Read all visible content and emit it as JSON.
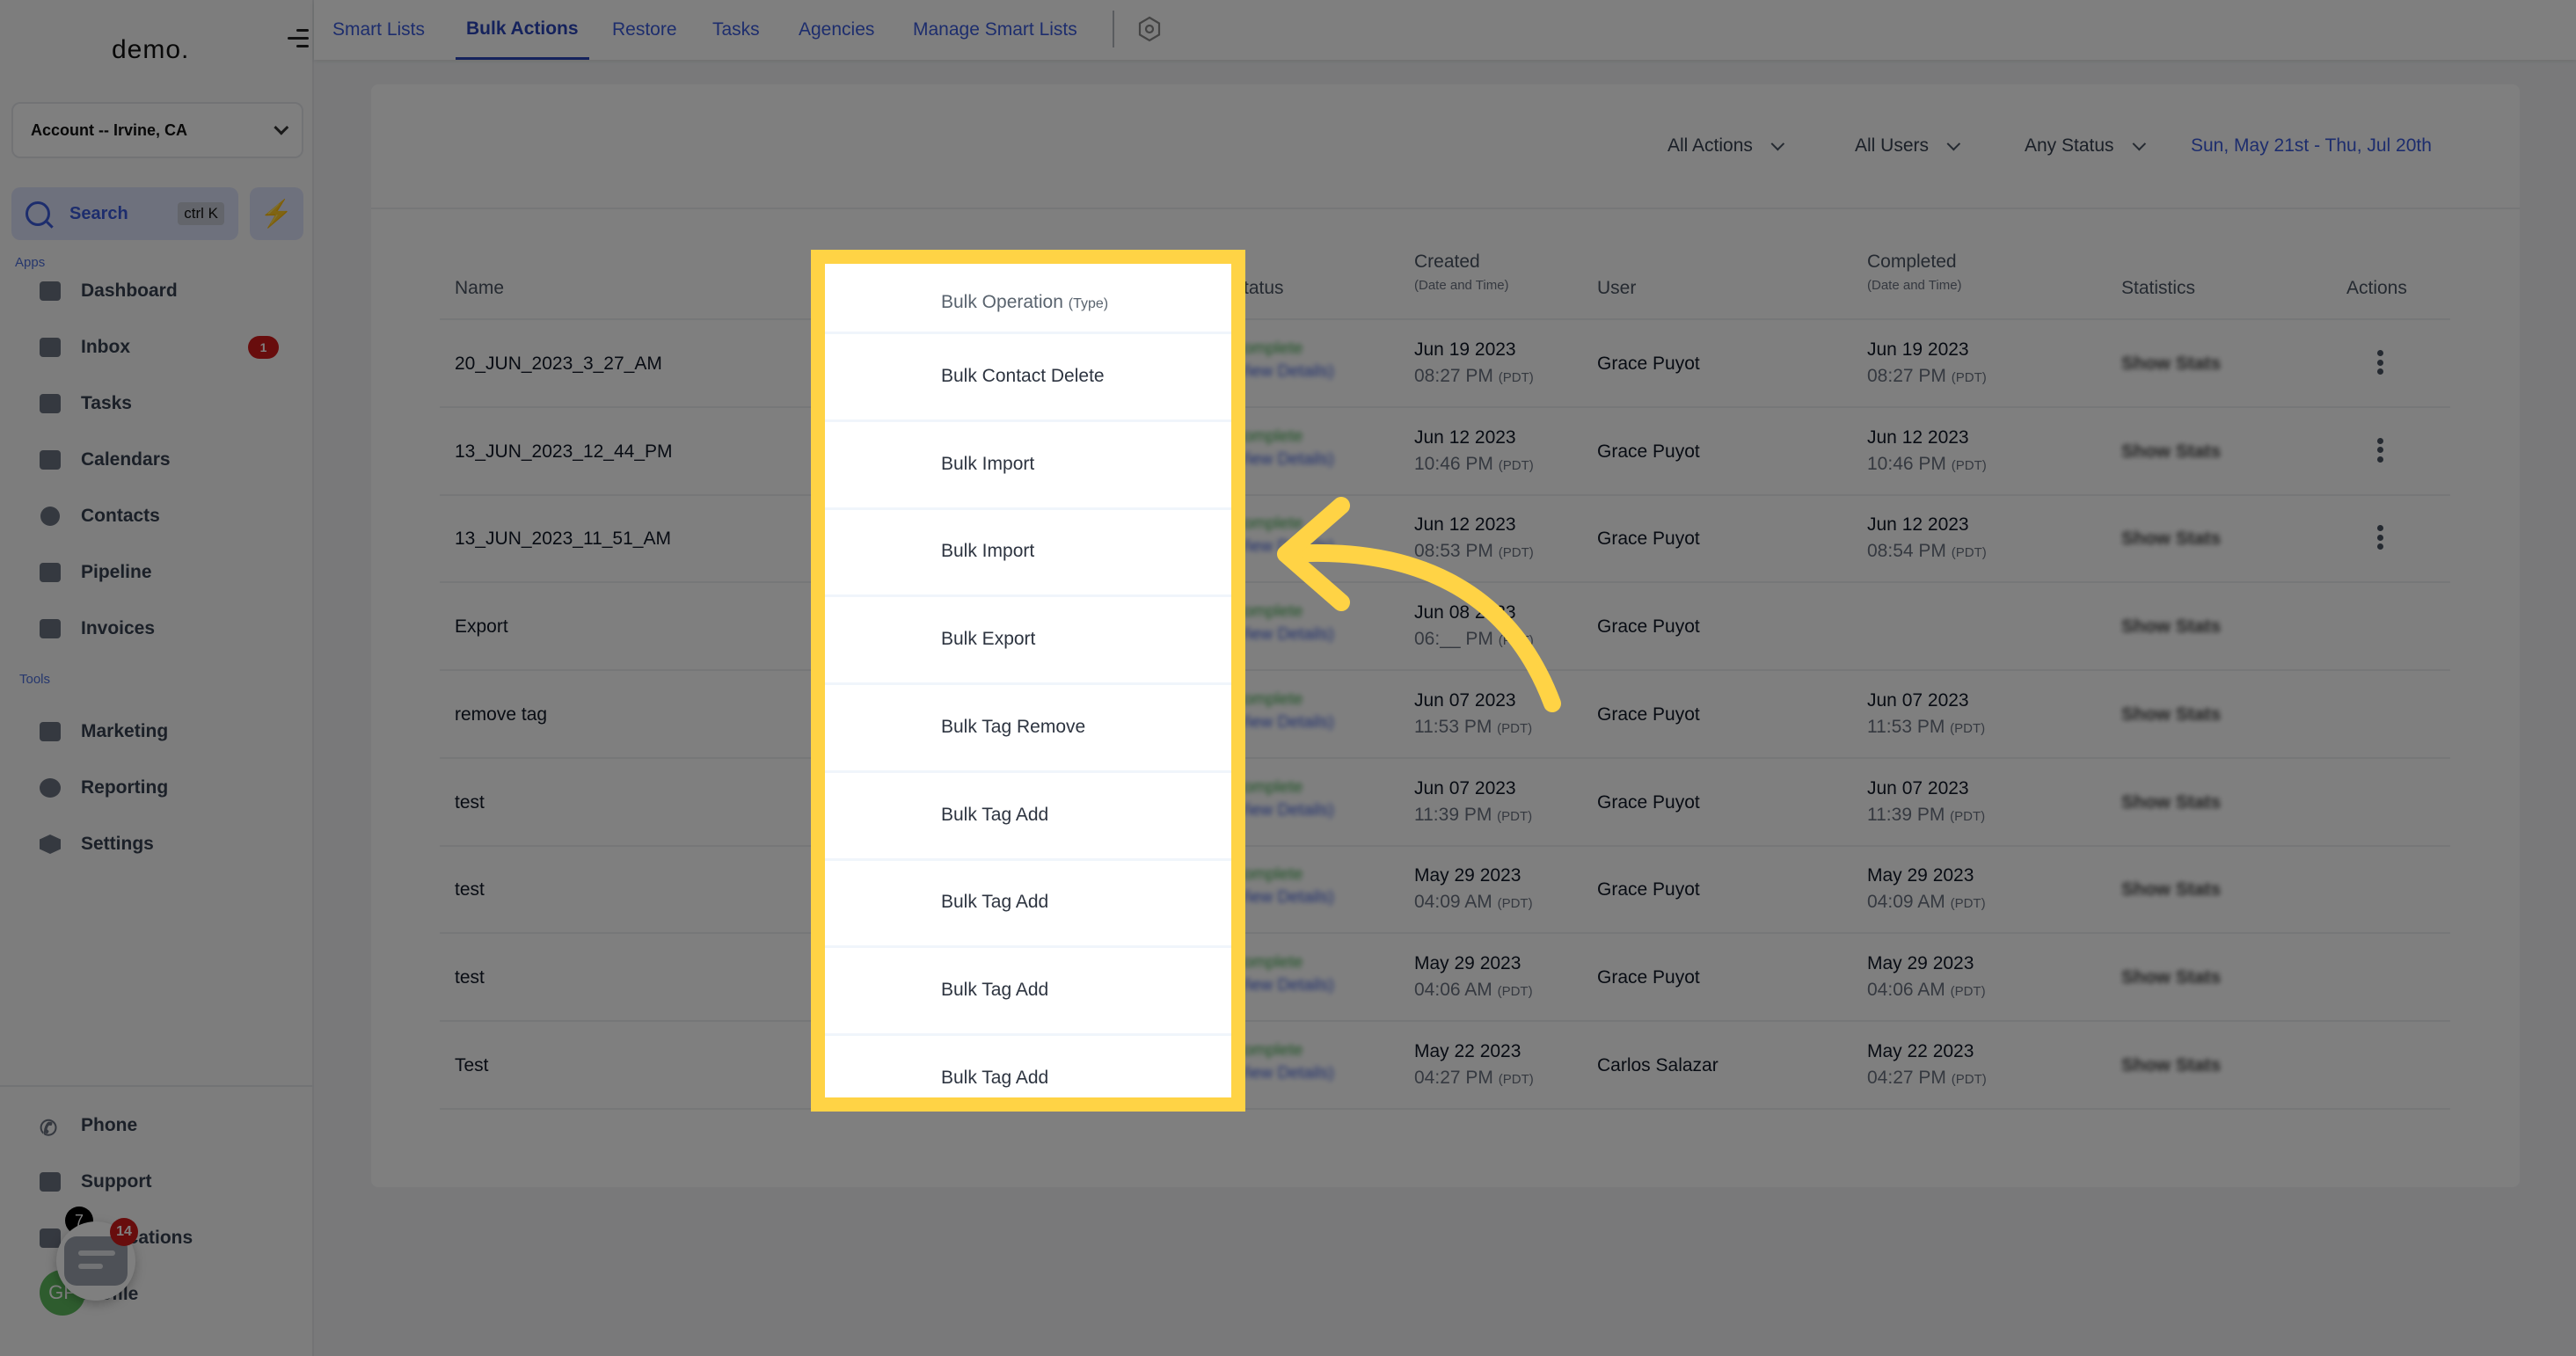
{
  "sidebar": {
    "logo": "demo.",
    "account": "Account -- Irvine, CA",
    "search": {
      "label": "Search",
      "shortcut": "ctrl K"
    },
    "sections": {
      "apps": "Apps",
      "tools": "Tools"
    },
    "apps": [
      {
        "label": "Dashboard",
        "icon": "dashboard-icon"
      },
      {
        "label": "Inbox",
        "icon": "inbox-icon",
        "badge": "1"
      },
      {
        "label": "Tasks",
        "icon": "tasks-icon"
      },
      {
        "label": "Calendars",
        "icon": "calendar-icon"
      },
      {
        "label": "Contacts",
        "icon": "contacts-icon"
      },
      {
        "label": "Pipeline",
        "icon": "pipeline-icon"
      },
      {
        "label": "Invoices",
        "icon": "invoices-icon"
      }
    ],
    "tools": [
      {
        "label": "Marketing",
        "icon": "megaphone-icon"
      },
      {
        "label": "Reporting",
        "icon": "pie-chart-icon"
      },
      {
        "label": "Settings",
        "icon": "settings-icon"
      }
    ],
    "bottom": [
      {
        "label": "Phone",
        "icon": "phone-icon"
      },
      {
        "label": "Support",
        "icon": "support-icon"
      },
      {
        "label": "Notifications",
        "icon": "bell-icon"
      },
      {
        "label": "Profile",
        "icon": "avatar"
      }
    ],
    "avatar_initials": "GP",
    "notification_badge": "7",
    "chat_badge": "14"
  },
  "topnav": {
    "tabs": [
      "Smart Lists",
      "Bulk Actions",
      "Restore",
      "Tasks",
      "Agencies",
      "Manage Smart Lists"
    ],
    "active_tab": "Bulk Actions"
  },
  "filters": {
    "actions": "All Actions",
    "users": "All Users",
    "status": "Any Status",
    "date_range": "Sun, May 21st - Thu, Jul 20th"
  },
  "table": {
    "headers": {
      "name": "Name",
      "operation": "Bulk Operation",
      "operation_sub": "(Type)",
      "status": "Status",
      "created": "Created",
      "created_sub": "(Date and Time)",
      "user": "User",
      "completed": "Completed",
      "completed_sub": "(Date and Time)",
      "statistics": "Statistics",
      "actions": "Actions"
    },
    "status_text": "Complete",
    "view_details": "(View Details)",
    "show_stats": "Show Stats",
    "tz": "(PDT)",
    "rows": [
      {
        "name": "20_JUN_2023_3_27_AM",
        "operation": "Bulk Contact Delete",
        "created_date": "Jun 19 2023",
        "created_time": "08:27 PM",
        "user": "Grace Puyot",
        "completed_date": "Jun 19 2023",
        "completed_time": "08:27 PM",
        "has_menu": true
      },
      {
        "name": "13_JUN_2023_12_44_PM",
        "operation": "Bulk Import",
        "created_date": "Jun 12 2023",
        "created_time": "10:46 PM",
        "user": "Grace Puyot",
        "completed_date": "Jun 12 2023",
        "completed_time": "10:46 PM",
        "has_menu": true
      },
      {
        "name": "13_JUN_2023_11_51_AM",
        "operation": "Bulk Import",
        "created_date": "Jun 12 2023",
        "created_time": "08:53 PM",
        "user": "Grace Puyot",
        "completed_date": "Jun 12 2023",
        "completed_time": "08:54 PM",
        "has_menu": true
      },
      {
        "name": "Export",
        "operation": "Bulk Export",
        "created_date": "Jun 08 2023",
        "created_time": "06:__ PM",
        "user": "Grace Puyot",
        "completed_date": "",
        "completed_time": "",
        "has_menu": false
      },
      {
        "name": "remove tag",
        "operation": "Bulk Tag Remove",
        "created_date": "Jun 07 2023",
        "created_time": "11:53 PM",
        "user": "Grace Puyot",
        "completed_date": "Jun 07 2023",
        "completed_time": "11:53 PM",
        "has_menu": false
      },
      {
        "name": "test",
        "operation": "Bulk Tag Add",
        "created_date": "Jun 07 2023",
        "created_time": "11:39 PM",
        "user": "Grace Puyot",
        "completed_date": "Jun 07 2023",
        "completed_time": "11:39 PM",
        "has_menu": false
      },
      {
        "name": "test",
        "operation": "Bulk Tag Add",
        "created_date": "May 29 2023",
        "created_time": "04:09 AM",
        "user": "Grace Puyot",
        "completed_date": "May 29 2023",
        "completed_time": "04:09 AM",
        "has_menu": false
      },
      {
        "name": "test",
        "operation": "Bulk Tag Add",
        "created_date": "May 29 2023",
        "created_time": "04:06 AM",
        "user": "Grace Puyot",
        "completed_date": "May 29 2023",
        "completed_time": "04:06 AM",
        "has_menu": false
      },
      {
        "name": "Test",
        "operation": "Bulk Tag Add",
        "created_date": "May 22 2023",
        "created_time": "04:27 PM",
        "user": "Carlos Salazar",
        "completed_date": "May 22 2023",
        "completed_time": "04:27 PM",
        "has_menu": false
      }
    ]
  },
  "annotation": {
    "highlight_color": "#ffd345",
    "highlighted_column": "Bulk Operation (Type)"
  },
  "colors": {
    "accent": "#3b5bdb",
    "badge": "#d11a1a",
    "status_complete": "#3aa647"
  }
}
